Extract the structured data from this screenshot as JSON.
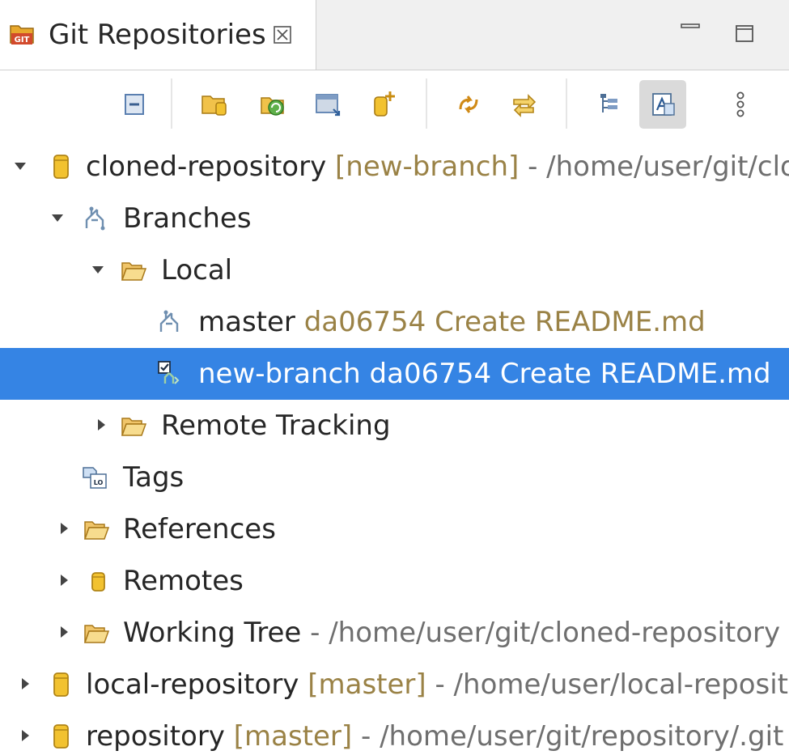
{
  "view_tab": {
    "title": "Git Repositories",
    "icon": "git-repositories-icon",
    "close_glyph": "☒"
  },
  "toolbar": {
    "items": [
      "collapse-all-icon",
      "add-existing-repository-icon",
      "clone-repository-icon",
      "import-projects-icon",
      "create-repository-icon",
      "refresh-icon",
      "link-with-selection-icon",
      "hierarchical-branch-layout-icon",
      "link-with-editor-icon",
      "view-menu-icon"
    ],
    "pressed": "link-with-editor-icon"
  },
  "tree": {
    "rows": [
      {
        "name": "repo-cloned",
        "text": "cloned-repository",
        "deco": "[new-branch]",
        "path": "- /home/user/git/cloned-repository/.git",
        "expanded": true
      },
      {
        "name": "branches",
        "text": "Branches",
        "expanded": true
      },
      {
        "name": "local",
        "text": "Local",
        "expanded": true
      },
      {
        "name": "branch-master",
        "text": "master",
        "deco": "da06754 Create README.md"
      },
      {
        "name": "branch-new-branch",
        "text": "new-branch",
        "deco": "da06754 Create README.md",
        "selected": true,
        "checked_out": true
      },
      {
        "name": "remote-tracking",
        "text": "Remote Tracking",
        "expanded": false
      },
      {
        "name": "tags",
        "text": "Tags"
      },
      {
        "name": "references",
        "text": "References",
        "expanded": false
      },
      {
        "name": "remotes",
        "text": "Remotes",
        "expanded": false
      },
      {
        "name": "working-tree",
        "text": "Working Tree",
        "path": "- /home/user/git/cloned-repository",
        "expanded": false
      },
      {
        "name": "repo-local",
        "text": "local-repository",
        "deco": "[master]",
        "path": "- /home/user/local-repository/.git",
        "expanded": false
      },
      {
        "name": "repo-repository",
        "text": "repository",
        "deco": "[master]",
        "path": "- /home/user/git/repository/.git",
        "expanded": false
      }
    ]
  },
  "colors": {
    "selection": "#3584e4",
    "decoration": "#9a8246",
    "path": "#6f6f6f",
    "repository_icon": "#f2c230"
  }
}
